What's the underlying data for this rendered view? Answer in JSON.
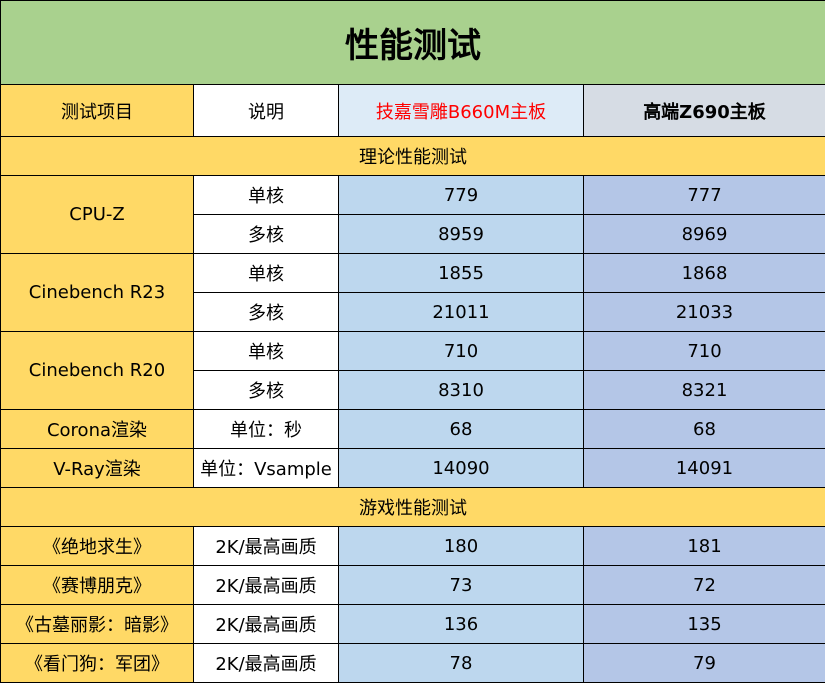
{
  "title": "性能测试",
  "headers": {
    "item": "测试项目",
    "desc": "说明",
    "board_a": "技嘉雪雕B660M主板",
    "board_b": "高端Z690主板"
  },
  "sections": {
    "theory": "理论性能测试",
    "game": "游戏性能测试"
  },
  "theory_groups": [
    {
      "name": "CPU-Z",
      "rows": [
        {
          "desc": "单核",
          "a": "779",
          "b": "777"
        },
        {
          "desc": "多核",
          "a": "8959",
          "b": "8969"
        }
      ]
    },
    {
      "name": "Cinebench R23",
      "rows": [
        {
          "desc": "单核",
          "a": "1855",
          "b": "1868"
        },
        {
          "desc": "多核",
          "a": "21011",
          "b": "21033"
        }
      ]
    },
    {
      "name": "Cinebench R20",
      "rows": [
        {
          "desc": "单核",
          "a": "710",
          "b": "710"
        },
        {
          "desc": "多核",
          "a": "8310",
          "b": "8321"
        }
      ]
    },
    {
      "name": "Corona渲染",
      "rows": [
        {
          "desc": "单位：秒",
          "a": "68",
          "b": "68"
        }
      ]
    },
    {
      "name": "V-Ray渲染",
      "rows": [
        {
          "desc": "单位：Vsample",
          "a": "14090",
          "b": "14091"
        }
      ]
    }
  ],
  "game_rows": [
    {
      "name": "《绝地求生》",
      "desc": "2K/最高画质",
      "a": "180",
      "b": "181"
    },
    {
      "name": "《赛博朋克》",
      "desc": "2K/最高画质",
      "a": "73",
      "b": "72"
    },
    {
      "name": "《古墓丽影：暗影》",
      "desc": "2K/最高画质",
      "a": "136",
      "b": "135"
    },
    {
      "name": "《看门狗：军团》",
      "desc": "2K/最高画质",
      "a": "78",
      "b": "79"
    }
  ]
}
